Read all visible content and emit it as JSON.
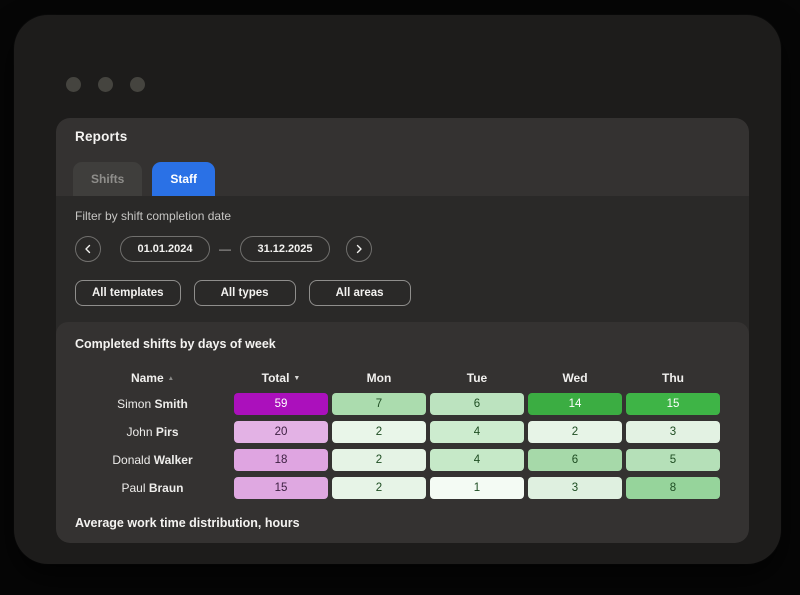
{
  "reports": {
    "title": "Reports",
    "tabs": [
      {
        "label": "Shifts",
        "active": false
      },
      {
        "label": "Staff",
        "active": true
      }
    ],
    "filter": {
      "label": "Filter by shift completion date",
      "date_from": "01.01.2024",
      "date_to": "31.12.2025",
      "range_separator": "—",
      "buttons": [
        "All templates",
        "All types",
        "All areas"
      ]
    },
    "section": {
      "title": "Completed shifts by days of week",
      "footer": "Average work time distribution, hours"
    }
  },
  "colors": {
    "accent_blue": "#2a71e6",
    "total_high": "#ab10bc",
    "day_high": "#3bad42"
  },
  "table": {
    "columns": [
      {
        "label": "Name",
        "sort": "asc"
      },
      {
        "label": "Total",
        "sort": "desc"
      },
      {
        "label": "Mon"
      },
      {
        "label": "Tue"
      },
      {
        "label": "Wed"
      },
      {
        "label": "Thu"
      }
    ],
    "rows": [
      {
        "first": "Simon",
        "last": "Smith",
        "cells": [
          {
            "v": 59,
            "bg": "#ab10bc",
            "fg": "#ffffff"
          },
          {
            "v": 7,
            "bg": "#abdcae",
            "fg": "#1e4d22"
          },
          {
            "v": 6,
            "bg": "#bce3bf",
            "fg": "#1e4d22"
          },
          {
            "v": 14,
            "bg": "#3bad42",
            "fg": "#ffffff"
          },
          {
            "v": 15,
            "bg": "#3eb446",
            "fg": "#ffffff"
          }
        ]
      },
      {
        "first": "John",
        "last": "Pirs",
        "cells": [
          {
            "v": 20,
            "bg": "#e3b2e5",
            "fg": "#3d2042"
          },
          {
            "v": 2,
            "bg": "#e9f6e9",
            "fg": "#1e4d22"
          },
          {
            "v": 4,
            "bg": "#cdeccf",
            "fg": "#1e4d22"
          },
          {
            "v": 2,
            "bg": "#e7f4e7",
            "fg": "#1e4d22"
          },
          {
            "v": 3,
            "bg": "#e3f2e3",
            "fg": "#1e4d22"
          }
        ]
      },
      {
        "first": "Donald",
        "last": "Walker",
        "cells": [
          {
            "v": 18,
            "bg": "#dfa5e1",
            "fg": "#3d2042"
          },
          {
            "v": 2,
            "bg": "#e5f3e5",
            "fg": "#1e4d22"
          },
          {
            "v": 4,
            "bg": "#c6e9c8",
            "fg": "#1e4d22"
          },
          {
            "v": 6,
            "bg": "#a6d9a9",
            "fg": "#1e4d22"
          },
          {
            "v": 5,
            "bg": "#b5e0b8",
            "fg": "#1e4d22"
          }
        ]
      },
      {
        "first": "Paul",
        "last": "Braun",
        "cells": [
          {
            "v": 15,
            "bg": "#dfa8e1",
            "fg": "#3d2042"
          },
          {
            "v": 2,
            "bg": "#e7f4e7",
            "fg": "#1e4d22"
          },
          {
            "v": 1,
            "bg": "#f4fbf4",
            "fg": "#1e4d22"
          },
          {
            "v": 3,
            "bg": "#dff0e0",
            "fg": "#1e4d22"
          },
          {
            "v": 8,
            "bg": "#96d49b",
            "fg": "#1e4d22"
          }
        ]
      }
    ]
  }
}
